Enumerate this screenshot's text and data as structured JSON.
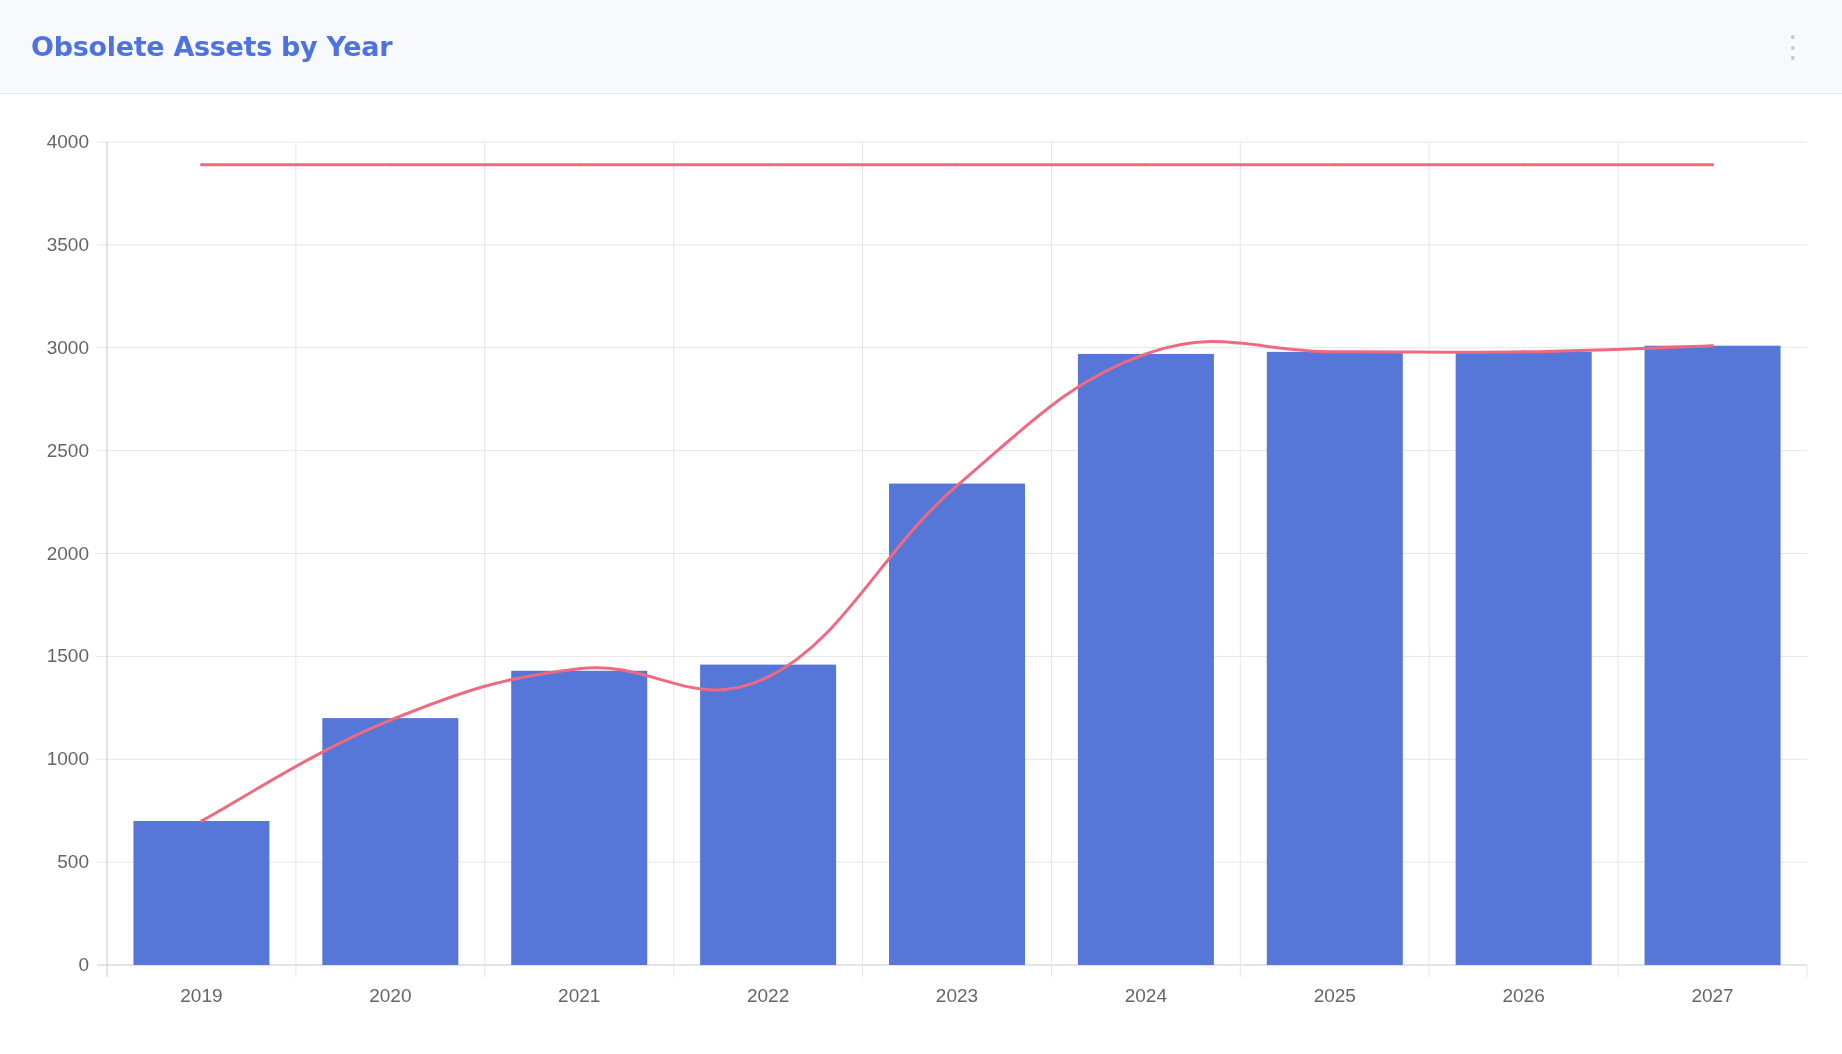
{
  "card": {
    "title": "Obsolete Assets by Year",
    "menu": "⋮",
    "chart_data": {
      "type": "bar",
      "categories": [
        "2019",
        "2020",
        "2021",
        "2022",
        "2023",
        "2024",
        "2025",
        "2026",
        "2027"
      ],
      "ylim": [
        0,
        4000
      ],
      "stacked": false,
      "grid": true,
      "yticks": [
        0,
        500,
        1000,
        1500,
        2000,
        2500,
        3000,
        3500,
        4000
      ],
      "series": [
        {
          "color": "#5677d8",
          "values": [
            700,
            1200,
            1430,
            1460,
            2340,
            2970,
            2980,
            2980,
            3010
          ]
        },
        {
          "type": "line",
          "color": "#ef6a80",
          "values": [
            700,
            1190,
            1440,
            1400,
            2330,
            2970,
            2980,
            2980,
            3010
          ]
        },
        {
          "type": "line",
          "color": "#ef6a80",
          "values": [
            3890,
            3890,
            3890,
            3890,
            3890,
            3890,
            3890,
            3890,
            3890
          ]
        }
      ]
    }
  }
}
